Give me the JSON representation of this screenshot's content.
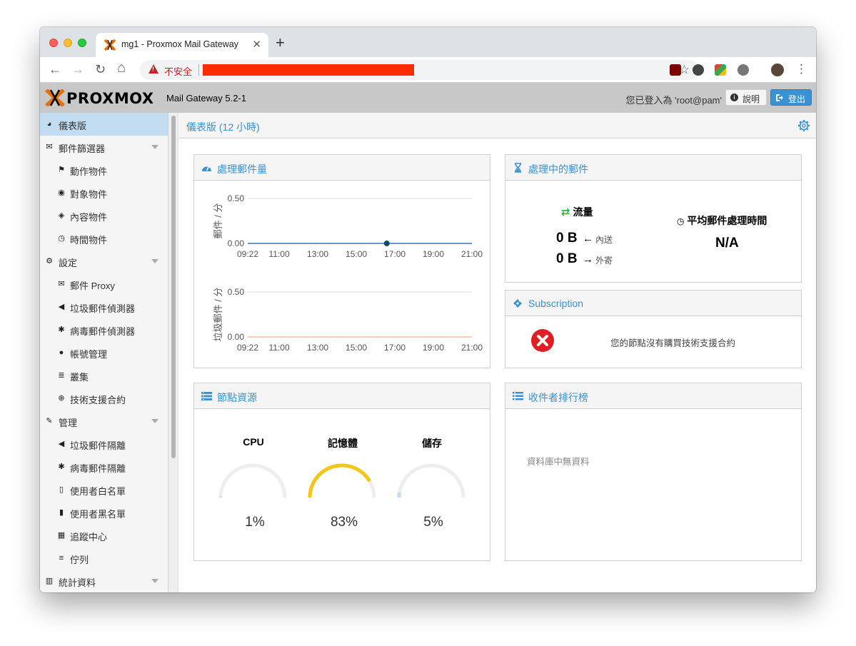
{
  "browser": {
    "tab_title": "mg1 - Proxmox Mail Gateway",
    "tab_close": "✕",
    "new_tab": "+",
    "insecure_label": "不安全",
    "nav_back": "←",
    "nav_forward": "→",
    "nav_reload": "↻",
    "nav_home": "⌂",
    "star": "☆",
    "menu": "⋮"
  },
  "header": {
    "logo_text": "PROXMOX",
    "version": "Mail Gateway 5.2-1",
    "logged_in": "您已登入為 'root@pam'",
    "help_label": "說明",
    "logout_label": "登出"
  },
  "sidebar": {
    "items": [
      {
        "label": "儀表版",
        "icon": "dashboard-icon",
        "glyph": "◕"
      },
      {
        "label": "郵件篩選器",
        "icon": "envelope-icon",
        "glyph": "✉"
      },
      {
        "label": "動作物件",
        "icon": "flag-icon",
        "glyph": "⚑"
      },
      {
        "label": "對象物件",
        "icon": "user-circle-icon",
        "glyph": "◉"
      },
      {
        "label": "內容物件",
        "icon": "cube-icon",
        "glyph": "◈"
      },
      {
        "label": "時間物件",
        "icon": "clock-icon",
        "glyph": "◷"
      },
      {
        "label": "設定",
        "icon": "gears-icon",
        "glyph": "⚙"
      },
      {
        "label": "郵件 Proxy",
        "icon": "envelope-outline-icon",
        "glyph": "✉"
      },
      {
        "label": "垃圾郵件偵測器",
        "icon": "bullhorn-icon",
        "glyph": "◀"
      },
      {
        "label": "病毒郵件偵測器",
        "icon": "bug-icon",
        "glyph": "✱"
      },
      {
        "label": "帳號管理",
        "icon": "users-icon",
        "glyph": "●"
      },
      {
        "label": "叢集",
        "icon": "server-icon",
        "glyph": "≣"
      },
      {
        "label": "技術支援合約",
        "icon": "life-ring-icon",
        "glyph": "⊕"
      },
      {
        "label": "管理",
        "icon": "wrench-icon",
        "glyph": "✎"
      },
      {
        "label": "垃圾郵件隔離",
        "icon": "bullhorn-icon",
        "glyph": "◀"
      },
      {
        "label": "病毒郵件隔離",
        "icon": "bug-icon",
        "glyph": "✱"
      },
      {
        "label": "使用者白名單",
        "icon": "file-outline-icon",
        "glyph": "▯"
      },
      {
        "label": "使用者黑名單",
        "icon": "file-icon",
        "glyph": "▮"
      },
      {
        "label": "追蹤中心",
        "icon": "map-icon",
        "glyph": "▦"
      },
      {
        "label": "佇列",
        "icon": "list-icon",
        "glyph": "≡"
      },
      {
        "label": "統計資料",
        "icon": "bar-chart-icon",
        "glyph": "▥"
      }
    ]
  },
  "main": {
    "title": "儀表版 (12 小時)"
  },
  "panels": {
    "mail_count": {
      "title": "處理郵件量"
    },
    "mail_processing": {
      "title": "處理中的郵件",
      "traffic_label": "流量",
      "in_value": "0 B",
      "in_label": "內送",
      "out_value": "0 B",
      "out_label": "外寄",
      "avg_label": "平均郵件處理時間",
      "avg_value": "N/A"
    },
    "subscription": {
      "title": "Subscription",
      "message": "您的節點沒有購買技術支援合約"
    },
    "node_resources": {
      "title": "節點資源",
      "cpu_label": "CPU",
      "cpu_value": "1%",
      "mem_label": "記憶體",
      "mem_value": "83%",
      "storage_label": "儲存",
      "storage_value": "5%"
    },
    "top_receivers": {
      "title": "收件者排行榜",
      "empty": "資料庫中無資料"
    }
  },
  "gauges": {
    "cpu": 0.01,
    "mem": 0.83,
    "storage": 0.05,
    "mem_color": "#f5c518",
    "low_color": "#c2ddf2",
    "track_color": "#eeeeee"
  },
  "colors": {
    "accent": "#3892d4",
    "header_bg": "#c8c8c8",
    "active_bg": "#c2ddf2",
    "logo_orange": "#e57000",
    "error_red": "#e21e25",
    "traffic_green": "#21bf3a"
  },
  "chart_data": [
    {
      "type": "line",
      "title": "",
      "ylabel": "郵件 / 分",
      "xlabel": "",
      "x_ticks": [
        "09:22",
        "11:00",
        "13:00",
        "15:00",
        "17:00",
        "19:00",
        "21:00"
      ],
      "y_ticks": [
        "0.00",
        "0.50"
      ],
      "ylim": [
        0,
        0.5
      ],
      "series": [
        {
          "x": [
            "09:22",
            "11:00",
            "13:00",
            "15:00",
            "16:35",
            "17:00",
            "19:00",
            "21:00"
          ],
          "values": [
            0,
            0,
            0,
            0,
            0,
            0,
            0,
            0
          ]
        }
      ],
      "series_color": "#115fa6",
      "highlight_point": {
        "x": "16:35",
        "y": 0
      }
    },
    {
      "type": "line",
      "title": "",
      "ylabel": "垃圾郵件 / 分",
      "xlabel": "",
      "x_ticks": [
        "09:22",
        "11:00",
        "13:00",
        "15:00",
        "17:00",
        "19:00",
        "21:00"
      ],
      "y_ticks": [
        "0.00",
        "0.50"
      ],
      "ylim": [
        0,
        0.5
      ],
      "series": [
        {
          "x": [
            "09:22",
            "11:00",
            "13:00",
            "15:00",
            "17:00",
            "19:00",
            "21:00"
          ],
          "values": [
            0,
            0,
            0,
            0,
            0,
            0,
            0
          ]
        }
      ],
      "series_color": "#f7b28d"
    }
  ]
}
